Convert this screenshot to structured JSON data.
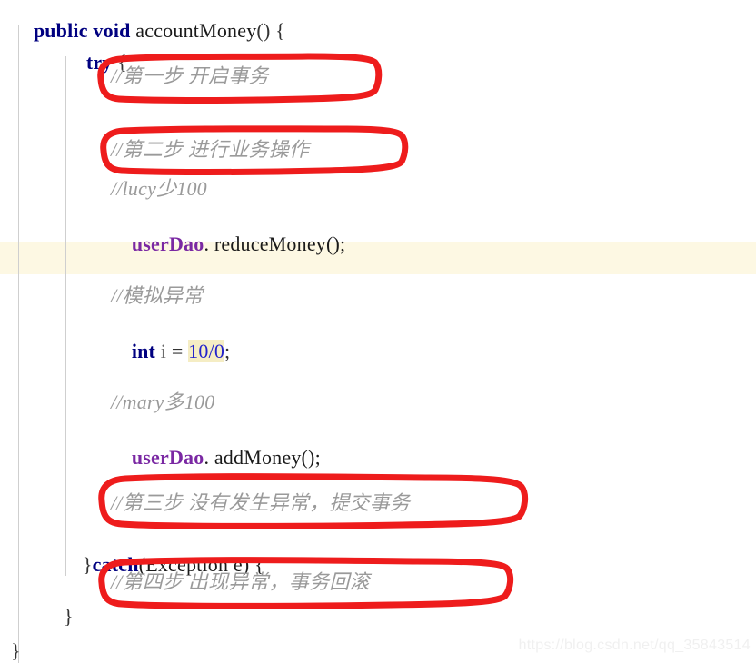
{
  "editor": {
    "language": "java",
    "background_color": "#ffffff",
    "caret_line_color": "#fdf8e3",
    "annotation_color": "#ee1c1c",
    "keyword_color": "#000080",
    "comment_color": "#9a9a9a",
    "field_color": "#7a28a3",
    "number_color": "#2222cc",
    "number_highlight_color": "#f5edc4"
  },
  "code": {
    "line1": {
      "kw_public": "public",
      "space1": " ",
      "kw_void": "void",
      "space2": " ",
      "method": "accountMoney",
      "tail": "() {"
    },
    "line2": {
      "kw_try": "try",
      "tail": " {"
    },
    "line3": {
      "comment": "//第一步 开启事务"
    },
    "line4": {
      "comment": "//第二步 进行业务操作"
    },
    "line5": {
      "comment": "//lucy少100"
    },
    "line6": {
      "field": "userDao",
      "call": ". reduceMoney();"
    },
    "line7": {
      "comment": "//模拟异常"
    },
    "line8": {
      "kw_int": "int",
      "var": " i ",
      "eq": "= ",
      "num": "10/0",
      "semi": ";"
    },
    "line9": {
      "comment": "//mary多100"
    },
    "line10": {
      "field": "userDao",
      "call": ". addMoney();"
    },
    "line11": {
      "comment": "//第三步 没有发生异常，提交事务"
    },
    "line12": {
      "brace": "}",
      "kw_catch": "catch",
      "tail": "(Exception e) {"
    },
    "line13": {
      "comment": "//第四步 出现异常，事务回滚"
    },
    "line14": {
      "brace": "}"
    },
    "line15": {
      "brace": "}"
    }
  },
  "annotations": [
    {
      "id": "step-1",
      "label": "//第一步 开启事务"
    },
    {
      "id": "step-2",
      "label": "//第二步 进行业务操作"
    },
    {
      "id": "step-3",
      "label": "//第三步 没有发生异常，提交事务"
    },
    {
      "id": "step-4",
      "label": "//第四步 出现异常，事务回滚"
    }
  ],
  "watermark": {
    "text": "https://blog.csdn.net/qq_35843514"
  }
}
